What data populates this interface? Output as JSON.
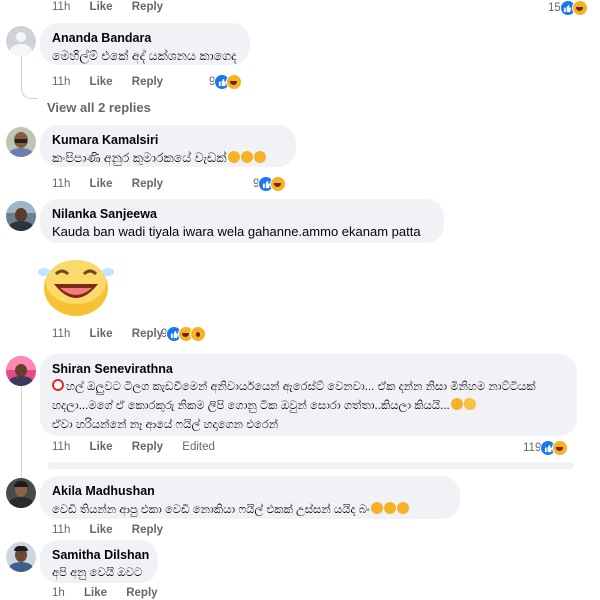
{
  "top_meta": {
    "time": "11h",
    "like": "Like",
    "reply": "Reply",
    "reactions": "15"
  },
  "comments": [
    {
      "name": "Ananda Bandara",
      "text": "මෙහිල්ම් එකේ අද් යක්ශනය කාගෙද",
      "time": "11h",
      "like": "Like",
      "reply": "Reply",
      "reactions": "9"
    },
    {
      "name": "Kumara Kamalsiri",
      "text": "කංපිපාණි අනුර කුමාරකයේ වැඩක්",
      "time": "11h",
      "like": "Like",
      "reply": "Reply",
      "reactions": "9"
    },
    {
      "name": "Nilanka Sanjeewa",
      "text": "Kauda ban wadi tiyala iwara wela gahanne.ammo ekanam patta",
      "sticker": "laughing-sticker",
      "time": "11h",
      "like": "Like",
      "reply": "Reply",
      "reactions": "9"
    },
    {
      "name": "Shiran Senevirathna",
      "lines": [
        "හල් ඔලුවට ටිලග කැඩවීමෙන් අනිවාර්යයෙන් ඇරෙස්ට් වෙනවා... ඒක දන්න නිසා මිනිහම නාට්ටියක්",
        "හදලා...මගේ ඒ කොරකුරු නිකම ලිපි ගොනු ටික ඔවුන් සොරා ගත්තා..කියලා කියයි...",
        "ඒවා හරියන්නේ නෑ ආයේ ෆයිල් හදාගෙන එරෙන්"
      ],
      "time": "11h",
      "like": "Like",
      "reply": "Reply",
      "edited": "Edited",
      "reactions": "119"
    },
    {
      "name": "Akila Madhushan",
      "text": "වෙඩි තියන්න ආපු එකා වෙඩි නොකියා ෆයිල් එකක් උස්සන් යයිද බං",
      "time": "11h",
      "like": "Like",
      "reply": "Reply"
    },
    {
      "name": "Samitha Dilshan",
      "text": "අපි අනු වෙයි ඔවට",
      "time": "1h",
      "like": "Like",
      "reply": "Reply"
    }
  ],
  "view_replies": "View all 2 replies"
}
